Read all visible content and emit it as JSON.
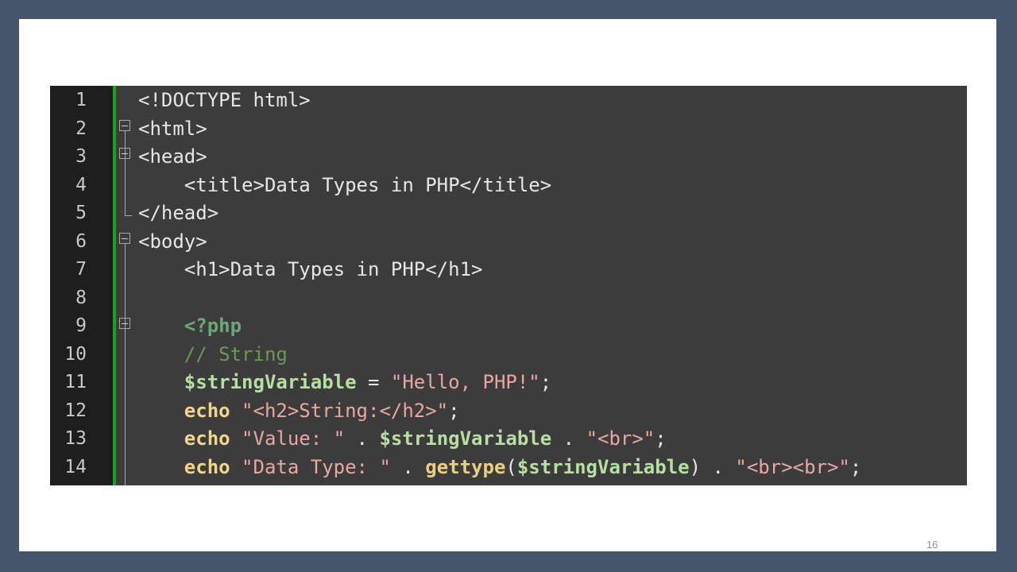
{
  "slide": {
    "page_number": "16"
  },
  "code": {
    "line_numbers": [
      "1",
      "2",
      "3",
      "4",
      "5",
      "6",
      "7",
      "8",
      "9",
      "10",
      "11",
      "12",
      "13",
      "14"
    ],
    "lines": [
      {
        "tokens": [
          {
            "t": "tag",
            "v": "<!DOCTYPE html>"
          }
        ]
      },
      {
        "tokens": [
          {
            "t": "tag",
            "v": "<html>"
          }
        ]
      },
      {
        "tokens": [
          {
            "t": "tag",
            "v": "<head>"
          }
        ]
      },
      {
        "tokens": [
          {
            "t": "tag",
            "v": "    <title>Data Types in PHP</title>"
          }
        ]
      },
      {
        "tokens": [
          {
            "t": "tag",
            "v": "</head>"
          }
        ]
      },
      {
        "tokens": [
          {
            "t": "tag",
            "v": "<body>"
          }
        ]
      },
      {
        "tokens": [
          {
            "t": "tag",
            "v": "    <h1>Data Types in PHP</h1>"
          }
        ]
      },
      {
        "tokens": [
          {
            "t": "tag",
            "v": ""
          }
        ]
      },
      {
        "tokens": [
          {
            "t": "op",
            "v": "    "
          },
          {
            "t": "php",
            "v": "<?php"
          }
        ]
      },
      {
        "tokens": [
          {
            "t": "op",
            "v": "    "
          },
          {
            "t": "comment",
            "v": "// String"
          }
        ]
      },
      {
        "tokens": [
          {
            "t": "op",
            "v": "    "
          },
          {
            "t": "var",
            "v": "$stringVariable"
          },
          {
            "t": "op",
            "v": " = "
          },
          {
            "t": "str",
            "v": "\"Hello, PHP!\""
          },
          {
            "t": "op",
            "v": ";"
          }
        ]
      },
      {
        "tokens": [
          {
            "t": "op",
            "v": "    "
          },
          {
            "t": "kw",
            "v": "echo"
          },
          {
            "t": "op",
            "v": " "
          },
          {
            "t": "str",
            "v": "\"<h2>String:</h2>\""
          },
          {
            "t": "op",
            "v": ";"
          }
        ]
      },
      {
        "tokens": [
          {
            "t": "op",
            "v": "    "
          },
          {
            "t": "kw",
            "v": "echo"
          },
          {
            "t": "op",
            "v": " "
          },
          {
            "t": "str",
            "v": "\"Value: \""
          },
          {
            "t": "op",
            "v": " . "
          },
          {
            "t": "var",
            "v": "$stringVariable"
          },
          {
            "t": "op",
            "v": " . "
          },
          {
            "t": "str",
            "v": "\"<br>\""
          },
          {
            "t": "op",
            "v": ";"
          }
        ]
      },
      {
        "tokens": [
          {
            "t": "op",
            "v": "    "
          },
          {
            "t": "kw",
            "v": "echo"
          },
          {
            "t": "op",
            "v": " "
          },
          {
            "t": "str",
            "v": "\"Data Type: \""
          },
          {
            "t": "op",
            "v": " . "
          },
          {
            "t": "fn",
            "v": "gettype"
          },
          {
            "t": "op",
            "v": "("
          },
          {
            "t": "var",
            "v": "$stringVariable"
          },
          {
            "t": "op",
            "v": ") . "
          },
          {
            "t": "str",
            "v": "\"<br><br>\""
          },
          {
            "t": "op",
            "v": ";"
          }
        ]
      }
    ]
  },
  "colors": {
    "frame": "#44546a",
    "gutter": "#1e1e1e",
    "editor": "#3c3c3c",
    "change_bar": "#1e9f1e"
  }
}
